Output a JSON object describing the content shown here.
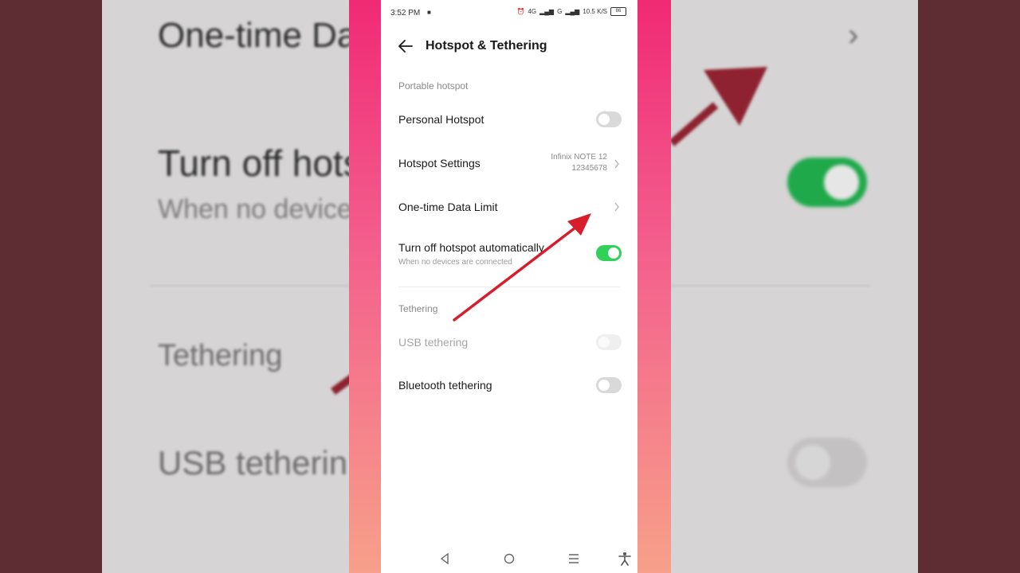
{
  "background": {
    "title_row": "One-time Da",
    "auto_off_label": "Turn off hots",
    "auto_off_sub": "When no device",
    "tethering_label": "Tethering",
    "usb_label": "USB tetherin",
    "chevron": "›"
  },
  "status_bar": {
    "time": "3:52 PM",
    "network_1": "4G",
    "network_2": "G",
    "speed": "10.5 K/S",
    "battery": "86"
  },
  "header": {
    "title": "Hotspot & Tethering"
  },
  "sections": {
    "portable_hotspot": "Portable hotspot",
    "tethering": "Tethering"
  },
  "items": {
    "personal_hotspot": {
      "label": "Personal Hotspot",
      "state": "off"
    },
    "hotspot_settings": {
      "label": "Hotspot Settings",
      "value_line1": "Infinix NOTE 12",
      "value_line2": "12345678"
    },
    "data_limit": {
      "label": "One-time Data Limit"
    },
    "auto_off": {
      "label": "Turn off hotspot automatically",
      "sublabel": "When no devices are connected",
      "state": "on"
    },
    "usb_tethering": {
      "label": "USB tethering",
      "state": "disabled"
    },
    "bluetooth_tethering": {
      "label": "Bluetooth tethering",
      "state": "off"
    }
  },
  "colors": {
    "toggle_on": "#2fd158",
    "toggle_off": "#d9d9d9",
    "annotation_arrow": "#d81e2c",
    "frame_gradient_top": "#f02a74",
    "frame_gradient_bottom": "#f7a08a"
  },
  "icons": {
    "back": "back-arrow-icon",
    "chevron": "chevron-right-icon",
    "nav_back": "triangle-back-icon",
    "nav_home": "circle-home-icon",
    "nav_recents": "menu-lines-icon",
    "accessibility": "accessibility-person-icon"
  }
}
